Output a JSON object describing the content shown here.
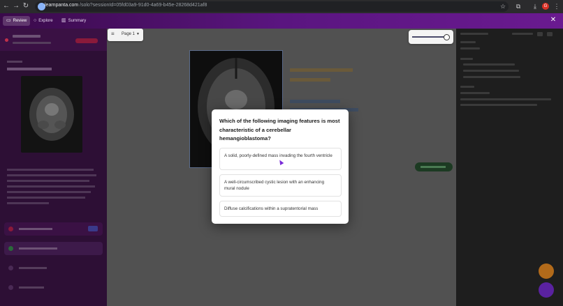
{
  "browser": {
    "url_host": "learnpanta.com",
    "url_path": "/solo?sessionId=05fd03a9-91d0-4a69-b45e-28268d421af8",
    "profile_initial": "G"
  },
  "app": {
    "tabs": [
      {
        "label": "Review",
        "icon": "book-icon"
      },
      {
        "label": "Explore",
        "icon": "search-icon"
      },
      {
        "label": "Summary",
        "icon": "bar-chart-icon"
      }
    ],
    "close_icon": "close-icon"
  },
  "viewer": {
    "page_label": "Page 1"
  },
  "quiz": {
    "question": "Which of the following imaging features is most characteristic of a cerebellar hemangioblastoma?",
    "choices": [
      "A solid, poorly-defined mass invading the fourth ventricle",
      "A well-circumscribed cystic lesion with an enhancing mural nodule",
      "Diffuse calcifications within a supratentorial mass"
    ]
  },
  "colors": {
    "accent_purple": "#5a1580",
    "modal_bg": "#ffffff"
  }
}
